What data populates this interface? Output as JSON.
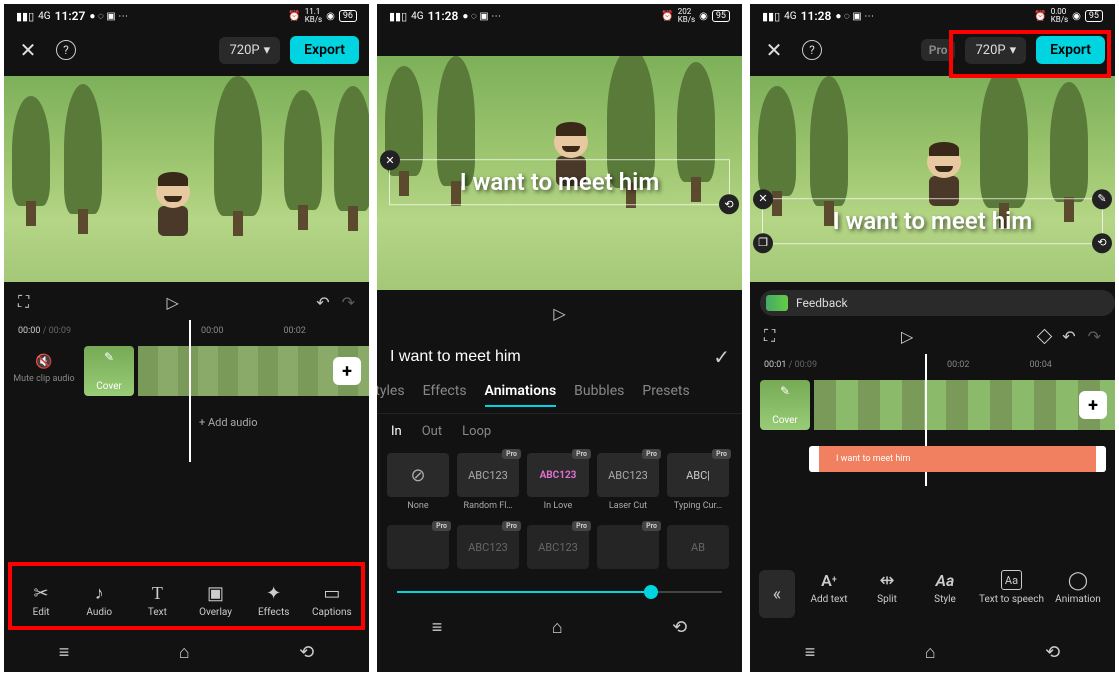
{
  "status": {
    "time1": "11:27",
    "time2": "11:28",
    "time3": "11:28",
    "net_left": "4G",
    "kbs1": "11.1\nKB/s",
    "kbs2": "202\nKB/s",
    "kbs3": "0.00\nKB/s",
    "batt1": "96",
    "batt2": "95",
    "batt3": "95"
  },
  "top": {
    "pro": "Pro",
    "resolution": "720P",
    "export": "Export"
  },
  "overlay_text": "I want to meet him",
  "feedback_label": "Feedback",
  "time": {
    "s1_cur": "00:00",
    "s1_dur": "/ 00:09",
    "marks1": [
      "00:00",
      "00:02"
    ],
    "s3_cur": "00:01",
    "s3_dur": "/ 00:09",
    "marks3": [
      "00:02",
      "00:04"
    ]
  },
  "mute_label": "Mute clip audio",
  "cover_label": "Cover",
  "add_audio": "+ Add audio",
  "tools1": {
    "edit": "Edit",
    "audio": "Audio",
    "text": "Text",
    "overlay": "Overlay",
    "effects": "Effects",
    "captions": "Captions"
  },
  "text_input_value": "I want to meet him",
  "tabs": {
    "styles": "Styles",
    "effects": "Effects",
    "animations": "Animations",
    "bubbles": "Bubbles",
    "presets": "Presets"
  },
  "subtabs": {
    "in": "In",
    "out": "Out",
    "loop": "Loop"
  },
  "anims_row1": [
    {
      "thumb": "⊘",
      "label": "None",
      "pro": false,
      "none": true
    },
    {
      "thumb": "ABC123",
      "label": "Random Fl…",
      "pro": true
    },
    {
      "thumb": "ABC123",
      "label": "In Love",
      "pro": true,
      "pink": true
    },
    {
      "thumb": "ABC123",
      "label": "Laser Cut",
      "pro": true
    },
    {
      "thumb": "ABC|",
      "label": "Typing Cur…",
      "pro": true,
      "cursor": true
    }
  ],
  "anims_row2": [
    {
      "thumb": "",
      "label": "",
      "pro": true,
      "gray": true
    },
    {
      "thumb": "ABC123",
      "label": "",
      "pro": true,
      "gray": true
    },
    {
      "thumb": "ABC123",
      "label": "",
      "pro": true,
      "gray": true
    },
    {
      "thumb": "",
      "label": "",
      "pro": true,
      "gray": true
    },
    {
      "thumb": "AB",
      "label": "",
      "pro": false,
      "gray": true
    }
  ],
  "tools3": {
    "addtext": "Add text",
    "split": "Split",
    "style": "Style",
    "tts": "Text to speech",
    "animation": "Animation"
  },
  "text_clip_label": "I want to meet him"
}
